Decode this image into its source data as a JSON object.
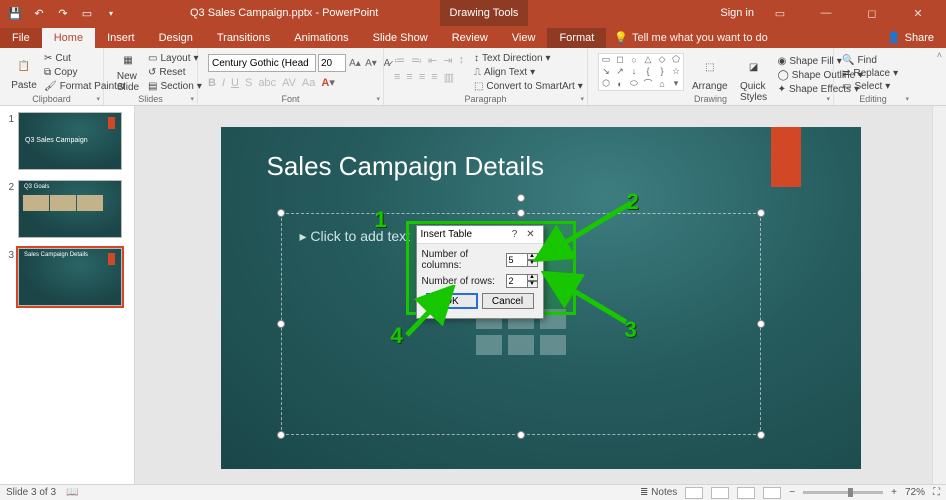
{
  "titlebar": {
    "doc_title": "Q3 Sales Campaign.pptx - PowerPoint",
    "contextual_tab_group": "Drawing Tools",
    "sign_in": "Sign in"
  },
  "tabs": {
    "file": "File",
    "home": "Home",
    "insert": "Insert",
    "design": "Design",
    "transitions": "Transitions",
    "animations": "Animations",
    "slideshow": "Slide Show",
    "review": "Review",
    "view": "View",
    "format": "Format",
    "tellme": "Tell me what you want to do",
    "share": "Share"
  },
  "ribbon": {
    "clipboard": {
      "label": "Clipboard",
      "paste": "Paste",
      "cut": "Cut",
      "copy": "Copy",
      "format_painter": "Format Painter"
    },
    "slides": {
      "label": "Slides",
      "new_slide": "New\nSlide",
      "layout": "Layout",
      "reset": "Reset",
      "section": "Section"
    },
    "font": {
      "label": "Font",
      "name": "Century Gothic (Head",
      "size": "20"
    },
    "paragraph": {
      "label": "Paragraph",
      "text_direction": "Text Direction",
      "align_text": "Align Text",
      "smart_art": "Convert to SmartArt"
    },
    "drawing": {
      "label": "Drawing",
      "arrange": "Arrange",
      "quick_styles": "Quick\nStyles",
      "shape_fill": "Shape Fill",
      "shape_outline": "Shape Outline",
      "shape_effects": "Shape Effects"
    },
    "editing": {
      "label": "Editing",
      "find": "Find",
      "replace": "Replace",
      "select": "Select"
    }
  },
  "thumbnails": [
    {
      "num": "1",
      "title": "Q3 Sales Campaign"
    },
    {
      "num": "2",
      "title": "Q3 Goals"
    },
    {
      "num": "3",
      "title": "Sales Campaign Details"
    }
  ],
  "slide": {
    "title": "Sales Campaign Details",
    "placeholder_text": "▸  Click to add text"
  },
  "dialog": {
    "title": "Insert Table",
    "columns_label": "Number of columns:",
    "columns_value": "5",
    "rows_label": "Number of rows:",
    "rows_value": "2",
    "ok": "OK",
    "cancel": "Cancel"
  },
  "annotations": {
    "n1": "1",
    "n2": "2",
    "n3": "3",
    "n4": "4"
  },
  "statusbar": {
    "slide_info": "Slide 3 of 3",
    "notes": "Notes",
    "zoom": "72%"
  }
}
